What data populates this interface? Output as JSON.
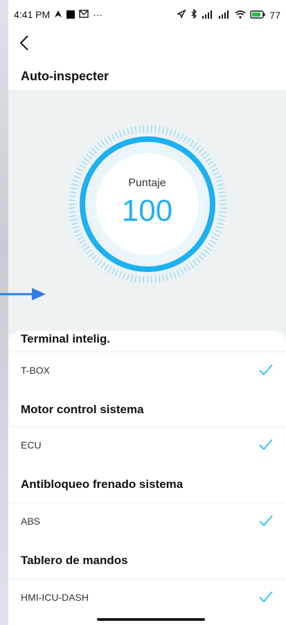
{
  "status": {
    "time": "4:41 PM",
    "dots": "···",
    "battery": "77"
  },
  "header": {
    "title": "Auto-inspecter"
  },
  "score": {
    "label": "Puntaje",
    "value": "100"
  },
  "sections": [
    {
      "title": "Terminal intelig.",
      "item": "T-BOX"
    },
    {
      "title": "Motor control sistema",
      "item": "ECU"
    },
    {
      "title": "Antibloqueo frenado sistema",
      "item": "ABS"
    },
    {
      "title": "Tablero de mandos",
      "item": "HMI-ICU-DASH"
    }
  ],
  "colors": {
    "accent": "#1fb1ee",
    "check": "#31c6f0"
  },
  "icons": [
    "back-arrow-icon",
    "check-icon",
    "wifi-icon",
    "bluetooth-icon",
    "signal-icon",
    "battery-icon",
    "location-icon"
  ]
}
